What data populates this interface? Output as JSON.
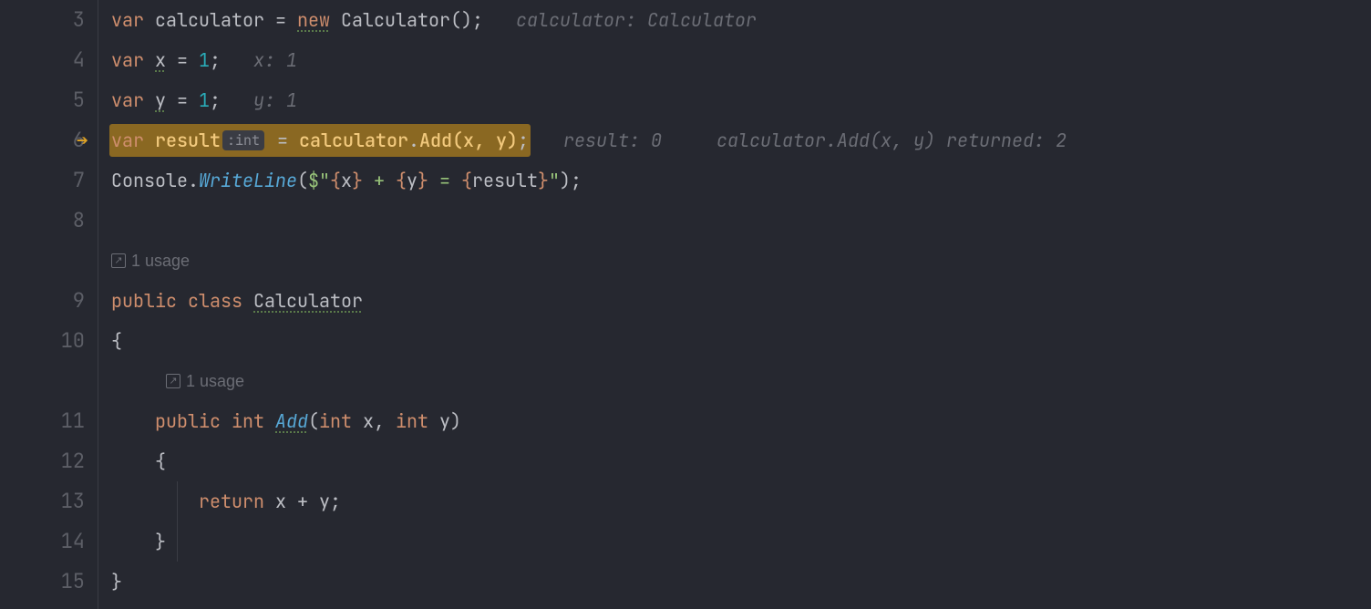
{
  "gutter": {
    "lines": [
      "3",
      "4",
      "5",
      "6",
      "7",
      "8",
      "",
      "9",
      "10",
      "",
      "11",
      "12",
      "13",
      "14",
      "15"
    ]
  },
  "code": {
    "l3": {
      "kw": "var",
      "name": "calculator",
      "eq": " = ",
      "new": "new",
      "type": " Calculator",
      "paren": "();",
      "hint": "calculator: Calculator"
    },
    "l4": {
      "kw": "var",
      "name": "x",
      "eq": " = ",
      "val": "1",
      "semi": ";",
      "hint": "x: 1"
    },
    "l5": {
      "kw": "var",
      "name": "y",
      "eq": " = ",
      "val": "1",
      "semi": ";",
      "hint": "y: 1"
    },
    "l6": {
      "kw": "var",
      "name": "result",
      "inlineType": ":int",
      "eq": " = ",
      "obj": "calculator",
      "dot": ".",
      "method": "Add",
      "args": "(x, y)",
      "semi": ";",
      "hint1": "result: 0",
      "hint2": "calculator.Add(x, y) returned: 2"
    },
    "l7": {
      "cls": "Console",
      "dot": ".",
      "method": "WriteLine",
      "op": "(",
      "interp": "$\"",
      "br1": "{",
      "v1": "x",
      "br1c": "}",
      "t1": " + ",
      "br2": "{",
      "v2": "y",
      "br2c": "}",
      "t2": " = ",
      "br3": "{",
      "v3": "result",
      "br3c": "}",
      "close": "\"",
      "cp": ");"
    },
    "usage1": "1 usage",
    "l9": {
      "pub": "public",
      "cls": "class",
      "name": "Calculator"
    },
    "l10": "{",
    "usage2": "1 usage",
    "l11": {
      "pub": "public",
      "ret": "int",
      "name": "Add",
      "sig": "(",
      "t1": "int",
      "p1": " x, ",
      "t2": "int",
      "p2": " y)"
    },
    "l12": "{",
    "l13": {
      "ret": "return",
      "expr": " x + y;"
    },
    "l14": "}",
    "l15": "}"
  }
}
